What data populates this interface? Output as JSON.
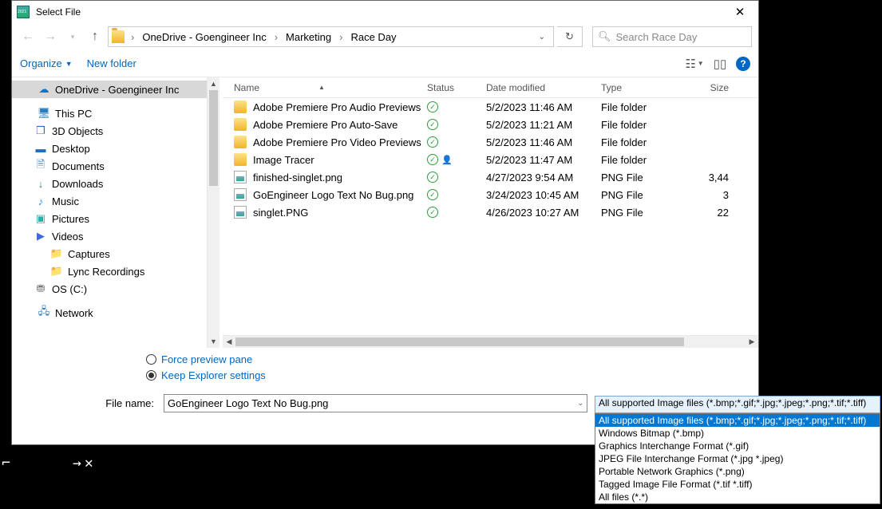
{
  "title": "Select File",
  "breadcrumb": {
    "a": "OneDrive - Goengineer Inc",
    "b": "Marketing",
    "c": "Race Day"
  },
  "search": {
    "placeholder": "Search Race Day"
  },
  "toolbar": {
    "organize": "Organize",
    "newfolder": "New folder"
  },
  "tree": {
    "onedrive": "OneDrive - Goengineer Inc",
    "thispc": "This PC",
    "obj3d": "3D Objects",
    "desktop": "Desktop",
    "documents": "Documents",
    "downloads": "Downloads",
    "music": "Music",
    "pictures": "Pictures",
    "videos": "Videos",
    "captures": "Captures",
    "lync": "Lync Recordings",
    "osc": "OS (C:)",
    "network": "Network"
  },
  "columns": {
    "name": "Name",
    "status": "Status",
    "date": "Date modified",
    "type": "Type",
    "size": "Size"
  },
  "rows": [
    {
      "name": "Adobe Premiere Pro Audio Previews",
      "kind": "folder",
      "shared": false,
      "date": "5/2/2023 11:46 AM",
      "type": "File folder",
      "size": ""
    },
    {
      "name": "Adobe Premiere Pro Auto-Save",
      "kind": "folder",
      "shared": false,
      "date": "5/2/2023 11:21 AM",
      "type": "File folder",
      "size": ""
    },
    {
      "name": "Adobe Premiere Pro Video Previews",
      "kind": "folder",
      "shared": false,
      "date": "5/2/2023 11:46 AM",
      "type": "File folder",
      "size": ""
    },
    {
      "name": "Image Tracer",
      "kind": "folder",
      "shared": true,
      "date": "5/2/2023 11:47 AM",
      "type": "File folder",
      "size": ""
    },
    {
      "name": "finished-singlet.png",
      "kind": "png",
      "shared": false,
      "date": "4/27/2023 9:54 AM",
      "type": "PNG File",
      "size": "3,44"
    },
    {
      "name": "GoEngineer Logo Text No Bug.png",
      "kind": "png",
      "shared": false,
      "date": "3/24/2023 10:45 AM",
      "type": "PNG File",
      "size": "3"
    },
    {
      "name": "singlet.PNG",
      "kind": "png",
      "shared": false,
      "date": "4/26/2023 10:27 AM",
      "type": "PNG File",
      "size": "22"
    }
  ],
  "options": {
    "force": "Force preview pane",
    "keep": "Keep Explorer settings"
  },
  "filename": {
    "label": "File name:",
    "value": "GoEngineer Logo Text No Bug.png"
  },
  "filter": {
    "current": "All supported Image files (*.bmp;*.gif;*.jpg;*.jpeg;*.png;*.tif;*.tiff)",
    "opts": [
      "All supported Image files (*.bmp;*.gif;*.jpg;*.jpeg;*.png;*.tif;*.tiff)",
      "Windows Bitmap (*.bmp)",
      "Graphics Interchange Format (*.gif)",
      "JPEG File Interchange Format (*.jpg *.jpeg)",
      "Portable Network Graphics (*.png)",
      "Tagged Image File Format (*.tif *.tiff)",
      "All files (*.*)"
    ]
  }
}
